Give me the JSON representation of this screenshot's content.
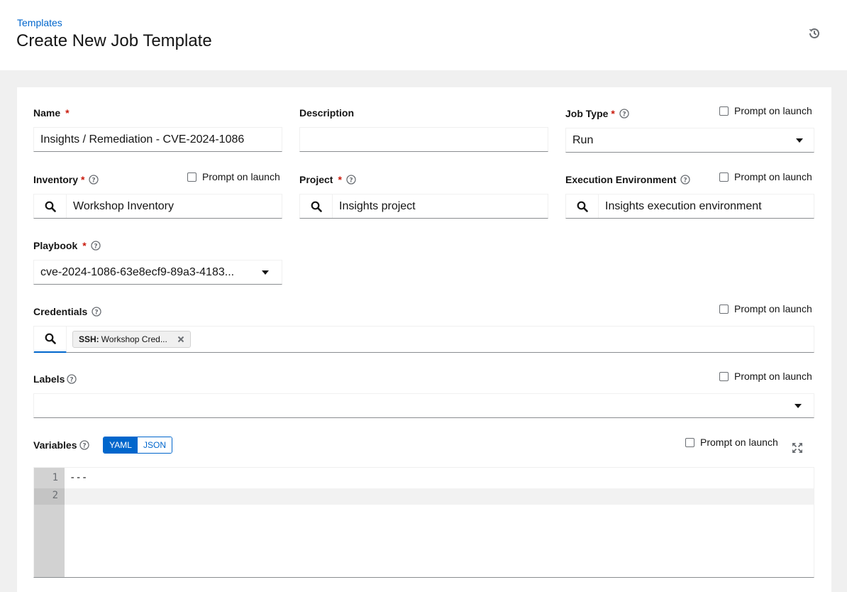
{
  "header": {
    "breadcrumb": "Templates",
    "title": "Create New Job Template"
  },
  "form": {
    "prompt_label": "Prompt on launch",
    "name": {
      "label": "Name",
      "value": "Insights / Remediation - CVE-2024-1086"
    },
    "description": {
      "label": "Description",
      "value": ""
    },
    "job_type": {
      "label": "Job Type",
      "value": "Run"
    },
    "inventory": {
      "label": "Inventory",
      "value": "Workshop Inventory"
    },
    "project": {
      "label": "Project",
      "value": "Insights project"
    },
    "execution_environment": {
      "label": "Execution Environment",
      "value": "Insights execution environment"
    },
    "playbook": {
      "label": "Playbook",
      "value": "cve-2024-1086-63e8ecf9-89a3-4183..."
    },
    "credentials": {
      "label": "Credentials",
      "chips": [
        {
          "type": "SSH:",
          "name": "Workshop Cred..."
        }
      ]
    },
    "labels": {
      "label": "Labels",
      "value": ""
    },
    "variables": {
      "label": "Variables",
      "modes": [
        "YAML",
        "JSON"
      ],
      "active_mode": "YAML",
      "lines": [
        "---",
        ""
      ],
      "line_numbers": [
        "1",
        "2"
      ]
    }
  },
  "icons": {
    "history": "history-icon",
    "help": "question-circle-icon",
    "search": "search-icon",
    "caret": "caret-down-icon",
    "remove": "times-icon",
    "expand": "expand-icon"
  },
  "colors": {
    "link": "#0066cc",
    "required": "#c9190b",
    "page_bg": "#f0f0f0"
  }
}
